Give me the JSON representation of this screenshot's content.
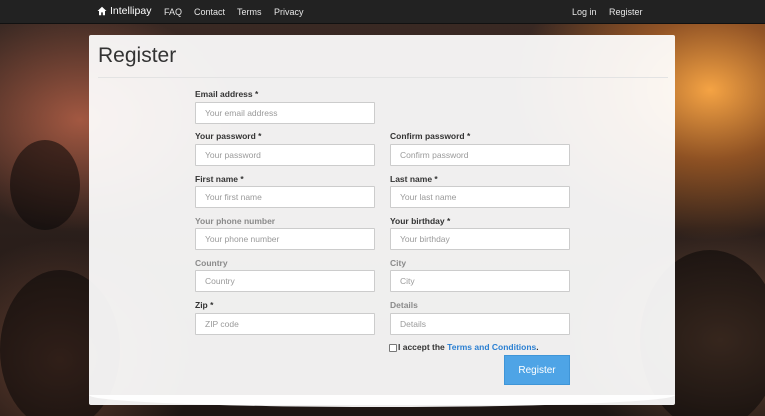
{
  "nav": {
    "brand": "Intellipay",
    "links": [
      "FAQ",
      "Contact",
      "Terms",
      "Privacy"
    ],
    "right_links": [
      "Log in",
      "Register"
    ]
  },
  "form": {
    "title": "Register",
    "fields": {
      "email": {
        "label": "Email address *",
        "placeholder": "Your email address"
      },
      "password": {
        "label": "Your password *",
        "placeholder": "Your password"
      },
      "confirm_password": {
        "label": "Confirm password *",
        "placeholder": "Confirm password"
      },
      "first_name": {
        "label": "First name *",
        "placeholder": "Your first name"
      },
      "last_name": {
        "label": "Last name *",
        "placeholder": "Your last name"
      },
      "phone": {
        "label": "Your phone number",
        "placeholder": "Your phone number"
      },
      "birthday": {
        "label": "Your birthday *",
        "placeholder": "Your birthday"
      },
      "country": {
        "label": "Country",
        "placeholder": "Country"
      },
      "city": {
        "label": "City",
        "placeholder": "City"
      },
      "zip": {
        "label": "Zip *",
        "placeholder": "ZIP code"
      },
      "details": {
        "label": "Details",
        "placeholder": "Details"
      }
    },
    "terms": {
      "prefix": "I accept the",
      "link": "Terms and Conditions",
      "suffix": "."
    },
    "submit_label": "Register"
  },
  "colors": {
    "navbar": "#222222",
    "accent": "#4ea4e6",
    "link": "#2a7fd2"
  },
  "icons": {
    "brand": "home-icon"
  }
}
